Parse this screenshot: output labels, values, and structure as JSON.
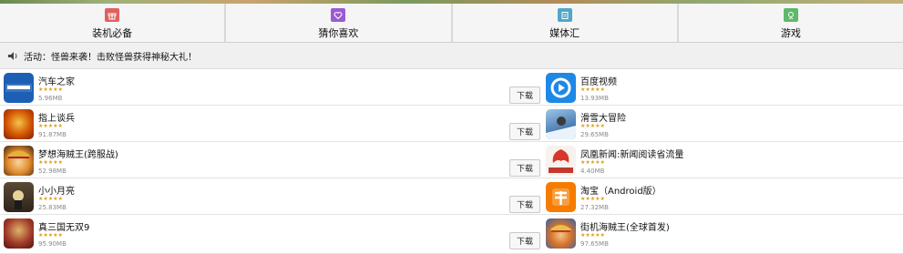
{
  "tabs": [
    {
      "label": "装机必备",
      "icon": "gift-icon",
      "color": "#e0605f"
    },
    {
      "label": "猜你喜欢",
      "icon": "heart-icon",
      "color": "#9b5bd1"
    },
    {
      "label": "媒体汇",
      "icon": "media-icon",
      "color": "#4fa7c9"
    },
    {
      "label": "游戏",
      "icon": "game-icon",
      "color": "#5fb96a"
    }
  ],
  "notice": {
    "text": "活动：怪兽来袭！击败怪兽获得神秘大礼！",
    "icon": "speaker-icon"
  },
  "download_label": "下载",
  "stars": "★★★★★",
  "apps_left": [
    {
      "name": "汽车之家",
      "size": "5.96MB",
      "icon": "autohome-icon",
      "color": "#1d5fb5"
    },
    {
      "name": "指上谈兵",
      "size": "91.87MB",
      "icon": "finger-war-icon",
      "color": "#c0392b"
    },
    {
      "name": "梦想海贼王(跨服战)",
      "size": "52.98MB",
      "icon": "pirate-dream-icon",
      "color": "#d35400"
    },
    {
      "name": "小小月亮",
      "size": "25.83MB",
      "icon": "little-moon-icon",
      "color": "#4a3b2a"
    },
    {
      "name": "真三国无双9",
      "size": "95.90MB",
      "icon": "three-kingdoms-icon",
      "color": "#8e2d22"
    }
  ],
  "apps_right": [
    {
      "name": "百度视频",
      "size": "13.93MB",
      "icon": "baidu-video-icon",
      "color": "#1e88e5"
    },
    {
      "name": "滑雪大冒险",
      "size": "29.65MB",
      "icon": "ski-safari-icon",
      "color": "#4f7fb3"
    },
    {
      "name": "凤凰新闻:新闻阅读省流量",
      "size": "4.40MB",
      "icon": "ifeng-news-icon",
      "color": "#c0392b"
    },
    {
      "name": "淘宝（Android版）",
      "size": "27.32MB",
      "icon": "taobao-icon",
      "color": "#f57c00"
    },
    {
      "name": "街机海贼王(全球首发)",
      "size": "97.65MB",
      "icon": "arcade-pirate-icon",
      "color": "#2f5fa8"
    }
  ]
}
